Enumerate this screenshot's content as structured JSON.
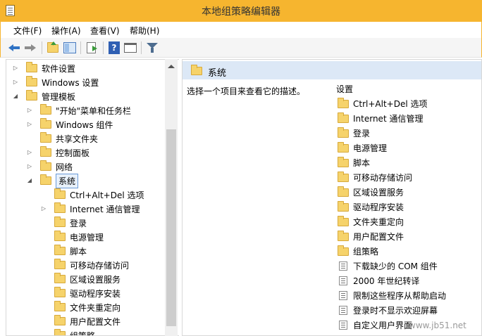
{
  "window": {
    "title": "本地组策略编辑器"
  },
  "menu": [
    "文件(F)",
    "操作(A)",
    "查看(V)",
    "帮助(H)"
  ],
  "toolbar": {
    "buttons": [
      "back-icon",
      "forward-icon",
      "up-folder-icon",
      "show-hide-tree-icon",
      "export-list-icon",
      "help-icon",
      "properties-icon",
      "filter-icon"
    ]
  },
  "tree": [
    {
      "label": "软件设置",
      "level": 1,
      "expander": "collapsed"
    },
    {
      "label": "Windows 设置",
      "level": 1,
      "expander": "collapsed"
    },
    {
      "label": "管理模板",
      "level": 1,
      "expander": "expanded"
    },
    {
      "label": "\"开始\"菜单和任务栏",
      "level": 2,
      "expander": "collapsed"
    },
    {
      "label": "Windows 组件",
      "level": 2,
      "expander": "collapsed"
    },
    {
      "label": "共享文件夹",
      "level": 2,
      "expander": "none"
    },
    {
      "label": "控制面板",
      "level": 2,
      "expander": "collapsed"
    },
    {
      "label": "网络",
      "level": 2,
      "expander": "collapsed"
    },
    {
      "label": "系统",
      "level": 2,
      "expander": "expanded",
      "selected": true
    },
    {
      "label": "Ctrl+Alt+Del 选项",
      "level": 3,
      "expander": "none"
    },
    {
      "label": "Internet 通信管理",
      "level": 3,
      "expander": "collapsed"
    },
    {
      "label": "登录",
      "level": 3,
      "expander": "none"
    },
    {
      "label": "电源管理",
      "level": 3,
      "expander": "none"
    },
    {
      "label": "脚本",
      "level": 3,
      "expander": "none"
    },
    {
      "label": "可移动存储访问",
      "level": 3,
      "expander": "none"
    },
    {
      "label": "区域设置服务",
      "level": 3,
      "expander": "none"
    },
    {
      "label": "驱动程序安装",
      "level": 3,
      "expander": "none"
    },
    {
      "label": "文件夹重定向",
      "level": 3,
      "expander": "none"
    },
    {
      "label": "用户配置文件",
      "level": 3,
      "expander": "none"
    },
    {
      "label": "组策略",
      "level": 3,
      "expander": "none"
    }
  ],
  "right": {
    "header_title": "系统",
    "description": "选择一个项目来查看它的描述。",
    "column_header": "设置",
    "items": [
      {
        "label": "Ctrl+Alt+Del 选项",
        "kind": "folder"
      },
      {
        "label": "Internet 通信管理",
        "kind": "folder"
      },
      {
        "label": "登录",
        "kind": "folder"
      },
      {
        "label": "电源管理",
        "kind": "folder"
      },
      {
        "label": "脚本",
        "kind": "folder"
      },
      {
        "label": "可移动存储访问",
        "kind": "folder"
      },
      {
        "label": "区域设置服务",
        "kind": "folder"
      },
      {
        "label": "驱动程序安装",
        "kind": "folder"
      },
      {
        "label": "文件夹重定向",
        "kind": "folder"
      },
      {
        "label": "用户配置文件",
        "kind": "folder"
      },
      {
        "label": "组策略",
        "kind": "folder"
      },
      {
        "label": "下载缺少的 COM 组件",
        "kind": "setting"
      },
      {
        "label": "2000 年世纪转译",
        "kind": "setting"
      },
      {
        "label": "限制这些程序从帮助启动",
        "kind": "setting"
      },
      {
        "label": "登录时不显示欢迎屏幕",
        "kind": "setting"
      },
      {
        "label": "自定义用户界面",
        "kind": "setting"
      }
    ]
  },
  "watermark": "www.jb51.net"
}
